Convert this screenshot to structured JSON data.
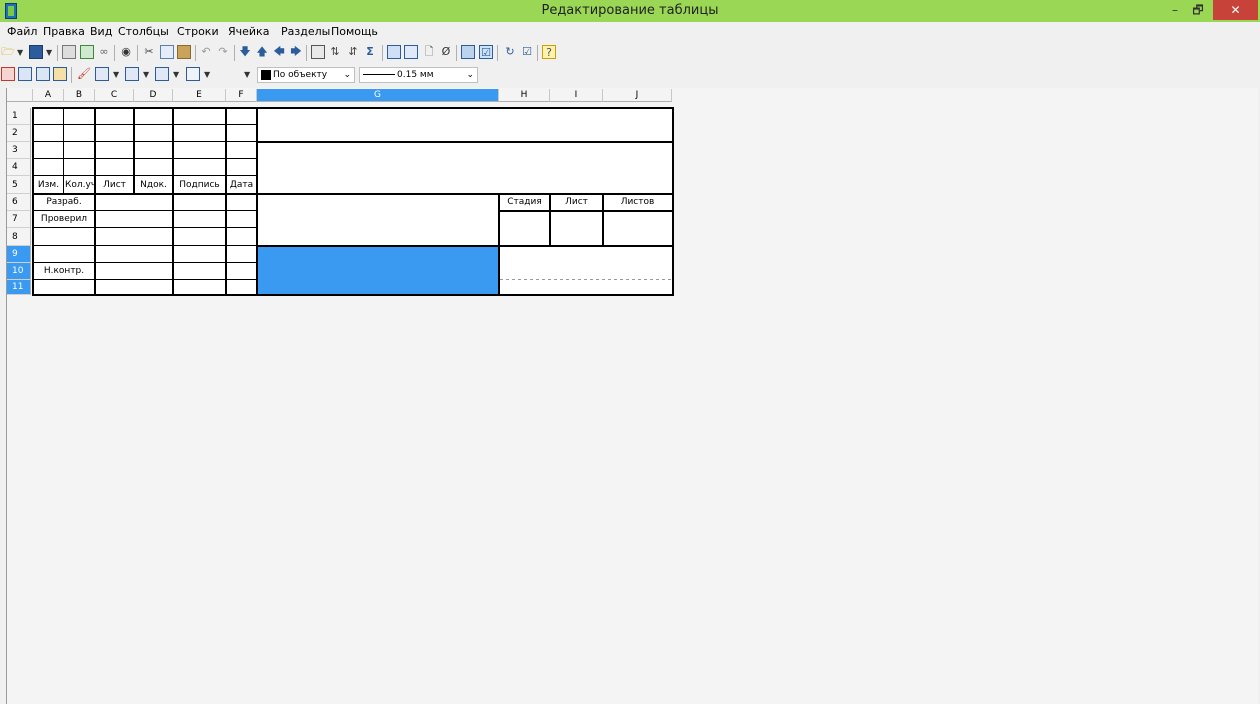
{
  "window": {
    "title": "Редактирование таблицы",
    "minimize": "–",
    "maximize": "🗗",
    "close": "✕"
  },
  "menu": [
    "Файл",
    "Правка",
    "Вид",
    "Столбцы",
    "Строки",
    "Ячейка",
    "Разделы",
    "Помощь"
  ],
  "toolbar2": {
    "fill_value": "По объекту",
    "line_value": "0.15 мм"
  },
  "columns": [
    "A",
    "B",
    "C",
    "D",
    "E",
    "F",
    "G",
    "H",
    "I",
    "J"
  ],
  "rows": [
    "1",
    "2",
    "3",
    "4",
    "5",
    "6",
    "7",
    "8",
    "9",
    "10",
    "11"
  ],
  "selection": {
    "column": "G",
    "rows": [
      "9",
      "10",
      "11"
    ]
  },
  "cells": {
    "r5": {
      "izm": "Изм.",
      "kolvo": "Кол.уч",
      "list": "Лист",
      "ndok": "Nдок.",
      "podpis": "Подпись",
      "data": "Дата"
    },
    "r6": {
      "razrab": "Разраб.",
      "stadiya": "Стадия",
      "list": "Лист",
      "listov": "Листов"
    },
    "r7": {
      "proveril": "Проверил"
    },
    "r10": {
      "nkontr": "Н.контр."
    }
  },
  "colors": {
    "titlebar": "#99d755",
    "selection": "#3a99f0",
    "close": "#c7433a"
  }
}
